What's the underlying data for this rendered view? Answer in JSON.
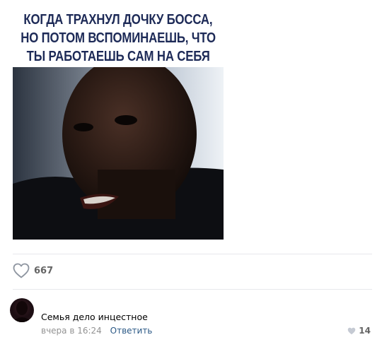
{
  "post": {
    "meme_lines": [
      "КОГДА ТРАХНУЛ ДОЧКУ БОССА,",
      "НО ПОТОМ ВСПОМИНАЕШЬ, ЧТО",
      "ТЫ РАБОТАЕШЬ САМ НА СЕБЯ"
    ],
    "likes": "667"
  },
  "comment": {
    "text": "Семья дело инцестное",
    "time": "вчера в 16:24",
    "reply_label": "Ответить",
    "likes": "14"
  },
  "colors": {
    "caption_text": "#1d2a57",
    "link": "#2a5885",
    "meta": "#939393",
    "divider": "#e7e8ec"
  }
}
